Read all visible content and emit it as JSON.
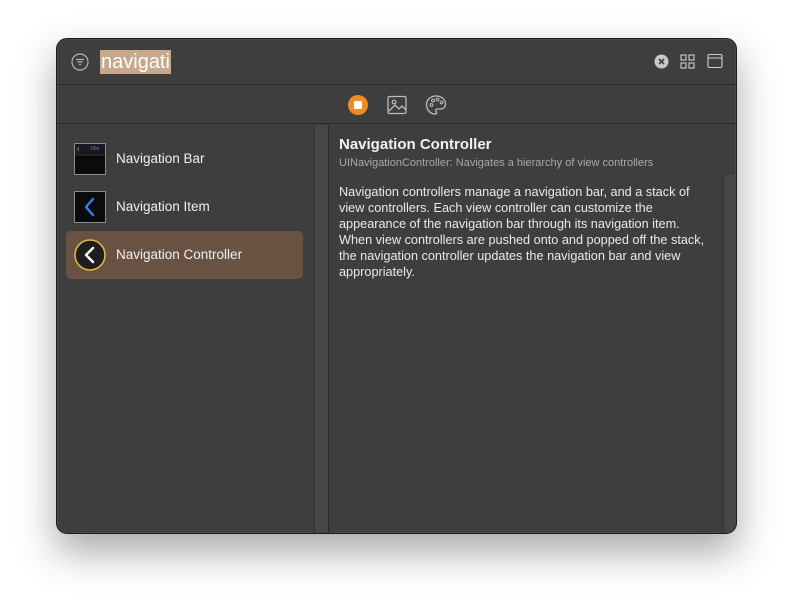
{
  "search": {
    "query": "navigati",
    "icons": {
      "filter": "filter-icon",
      "clear": "clear-icon",
      "grid": "grid-view-icon",
      "panel": "panel-icon"
    }
  },
  "tabs": [
    {
      "name": "objects",
      "icon": "stop-square-icon",
      "active": true,
      "accent": "#f08a24"
    },
    {
      "name": "media",
      "icon": "photo-icon",
      "active": false
    },
    {
      "name": "colors",
      "icon": "palette-icon",
      "active": false
    }
  ],
  "list": {
    "items": [
      {
        "label": "Navigation Bar",
        "thumb_text": "Title",
        "selected": false
      },
      {
        "label": "Navigation Item",
        "selected": false
      },
      {
        "label": "Navigation Controller",
        "selected": true
      }
    ]
  },
  "detail": {
    "title": "Navigation Controller",
    "subtitle": "UINavigationController: Navigates a hierarchy of view controllers",
    "description": "Navigation controllers manage a navigation bar, and a stack of view controllers. Each view controller can customize the appearance of the navigation bar through its navigation item. When view controllers are pushed onto and popped off the stack, the navigation controller updates the navigation bar and view appropriately."
  },
  "colors": {
    "window_bg": "#3e3e3e",
    "selection": "#6a5243",
    "search_highlight": "#c7a88c",
    "accent": "#f08a24",
    "chevron_blue": "#3b7cf5",
    "chevron_gold": "#d8b84a"
  }
}
